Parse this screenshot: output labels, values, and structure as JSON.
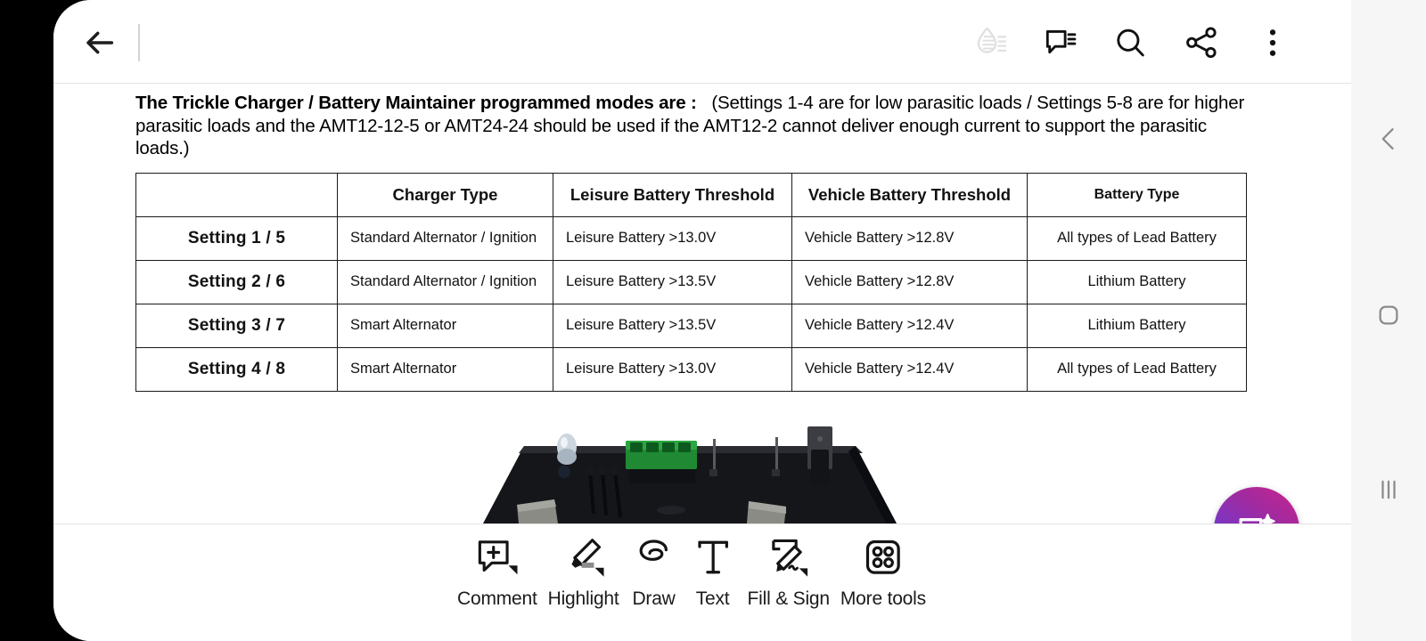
{
  "app": {
    "name": "pdf-reader"
  },
  "appbar": {
    "back_label": "Back",
    "icons": [
      {
        "name": "liquid-mode-icon",
        "label": "Liquid Mode",
        "enabled": false
      },
      {
        "name": "comments-icon",
        "label": "Comments",
        "enabled": true
      },
      {
        "name": "search-icon",
        "label": "Search",
        "enabled": true
      },
      {
        "name": "share-icon",
        "label": "Share",
        "enabled": true
      },
      {
        "name": "overflow-menu-icon",
        "label": "More options",
        "enabled": true
      }
    ]
  },
  "document": {
    "paragraph": {
      "bold_lead": "The Trickle Charger / Battery Maintainer programmed modes are :",
      "rest": "(Settings 1-4 are for low parasitic loads / Settings 5-8 are for higher parasitic loads and the AMT12-12-5 or AMT24-24 should be used if the AMT12-2 cannot deliver enough current to support the parasitic loads.)"
    },
    "table": {
      "headers": [
        "",
        "Charger Type",
        "Leisure Battery Threshold",
        "Vehicle Battery Threshold",
        "Battery Type"
      ],
      "rows": [
        {
          "setting": "Setting 1 / 5",
          "charger_type": "Standard Alternator / Ignition",
          "leisure_threshold": "Leisure Battery >13.0V",
          "vehicle_threshold": "Vehicle Battery >12.8V",
          "battery_type": "All types of Lead Battery"
        },
        {
          "setting": "Setting 2 / 6",
          "charger_type": "Standard Alternator / Ignition",
          "leisure_threshold": "Leisure Battery >13.5V",
          "vehicle_threshold": "Vehicle Battery >12.8V",
          "battery_type": "Lithium Battery"
        },
        {
          "setting": "Setting 3 / 7",
          "charger_type": "Smart Alternator",
          "leisure_threshold": "Leisure Battery >13.5V",
          "vehicle_threshold": "Vehicle Battery >12.4V",
          "battery_type": "Lithium Battery"
        },
        {
          "setting": "Setting 4 / 8",
          "charger_type": "Smart Alternator",
          "leisure_threshold": "Leisure Battery >13.0V",
          "vehicle_threshold": "Vehicle Battery >12.4V",
          "battery_type": "All types of Lead Battery"
        }
      ]
    },
    "photo": {
      "name": "circuit-board-photo",
      "description": "Black circuit board with green 4-way terminal block"
    }
  },
  "fab": {
    "name": "ai-assistant-button",
    "label": "AI Assistant",
    "gradient_from": "#c9248c",
    "gradient_to": "#5440da"
  },
  "bottom_toolbar": {
    "tools": [
      {
        "name": "comment-tool",
        "label": "Comment",
        "has_caret": true
      },
      {
        "name": "highlight-tool",
        "label": "Highlight",
        "has_caret": true
      },
      {
        "name": "draw-tool",
        "label": "Draw",
        "has_caret": false
      },
      {
        "name": "text-tool",
        "label": "Text",
        "has_caret": false
      },
      {
        "name": "fill-and-sign-tool",
        "label": "Fill & Sign",
        "has_caret": true
      },
      {
        "name": "more-tools",
        "label": "More tools",
        "has_caret": false
      }
    ]
  },
  "navbar": {
    "buttons": [
      {
        "name": "nav-back-button",
        "label": "Back"
      },
      {
        "name": "nav-home-button",
        "label": "Home"
      },
      {
        "name": "nav-recents-button",
        "label": "Recents"
      }
    ]
  }
}
